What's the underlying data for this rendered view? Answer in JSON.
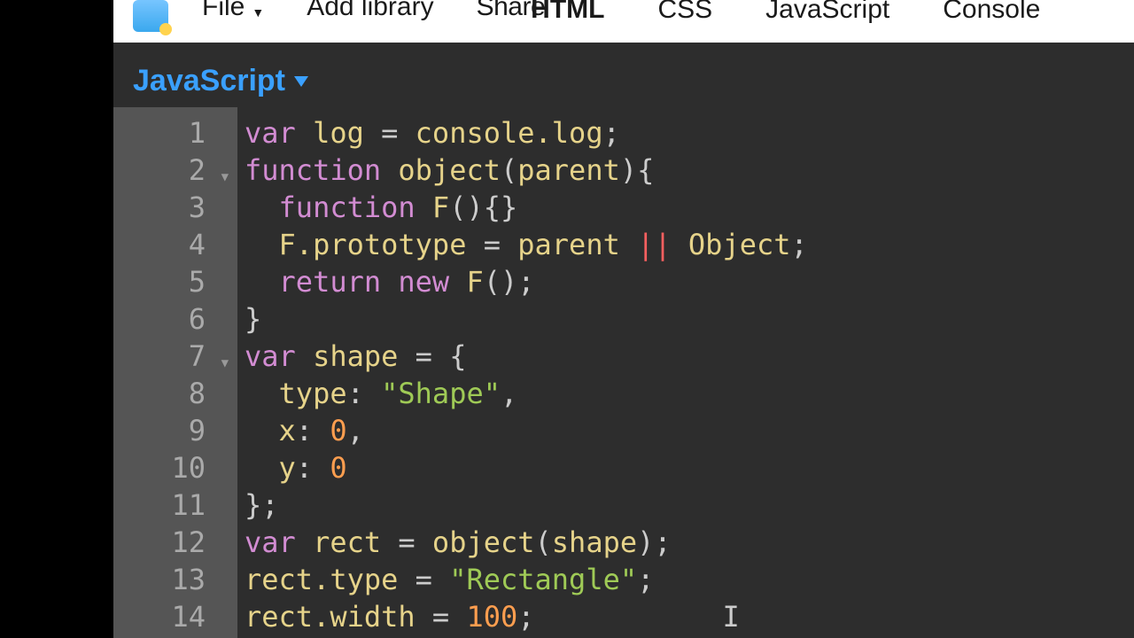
{
  "menu": {
    "file": "File",
    "add_library": "Add library",
    "share": "Share"
  },
  "tabs": {
    "html": "HTML",
    "css": "CSS",
    "javascript": "JavaScript",
    "console": "Console"
  },
  "editor": {
    "language_label": "JavaScript",
    "lines": {
      "n1": "1",
      "n2": "2",
      "n3": "3",
      "n4": "4",
      "n5": "5",
      "n6": "6",
      "n7": "7",
      "n8": "8",
      "n9": "9",
      "n10": "10",
      "n11": "11",
      "n12": "12",
      "n13": "13",
      "n14": "14"
    },
    "tok": {
      "var": "var",
      "function": "function",
      "return": "return",
      "new": "new",
      "log": "log",
      "console_log": "console.log",
      "object": "object",
      "parent": "parent",
      "F": "F",
      "F_prototype": "F.prototype",
      "Object": "Object",
      "pipes": "||",
      "shape": "shape",
      "type_key": "type",
      "x_key": "x",
      "y_key": "y",
      "zero": "0",
      "shape_str": "\"Shape\"",
      "rect": "rect",
      "rect_type": "rect.type",
      "rect_str": "\"Rectangle\"",
      "rect_width": "rect.width",
      "hundred": "100"
    }
  }
}
